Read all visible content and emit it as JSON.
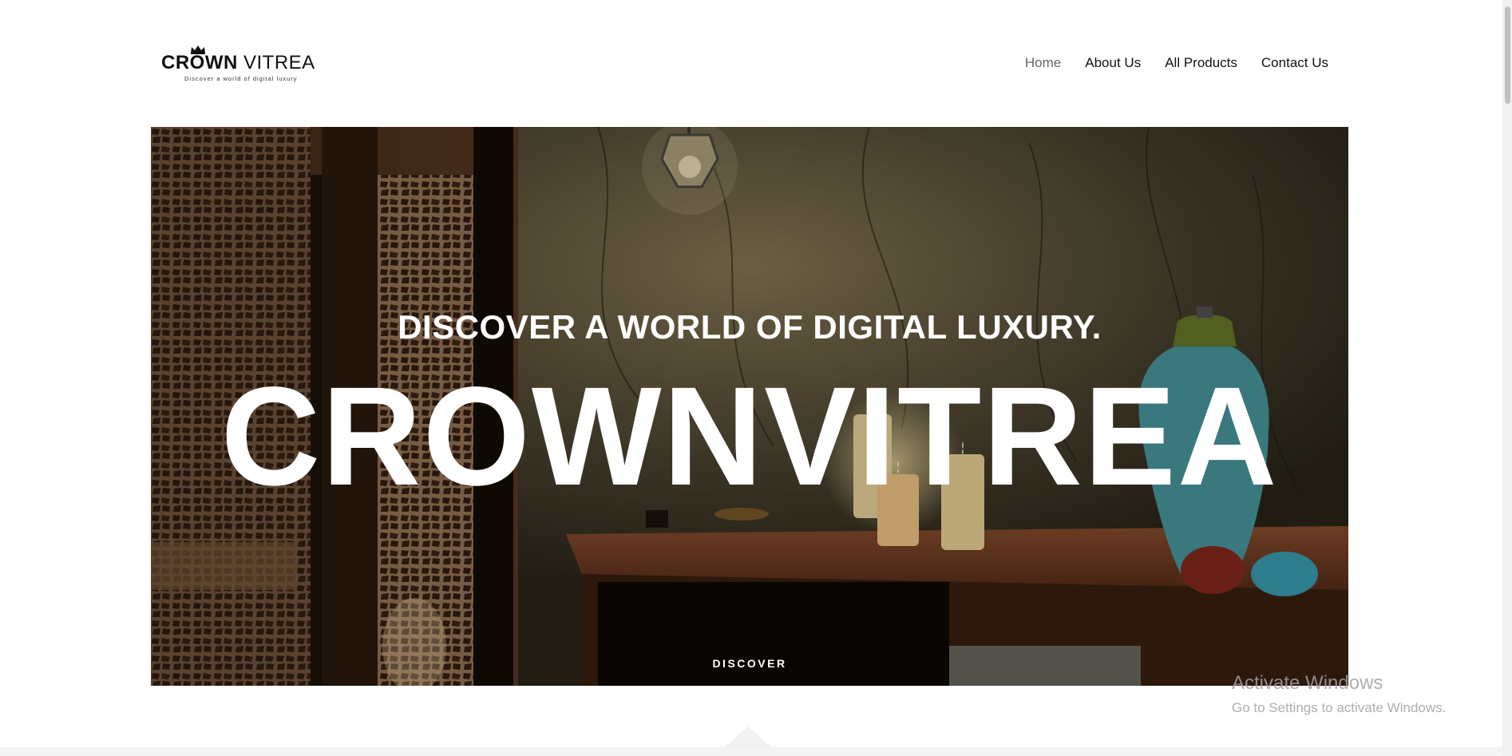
{
  "brand": {
    "name_bold": "CROWN",
    "name_light": "VITREA",
    "tagline": "Discover a world of digital luxury",
    "crown_icon": "crown-icon"
  },
  "nav": {
    "items": [
      {
        "label": "Home",
        "active": true
      },
      {
        "label": "About Us",
        "active": false
      },
      {
        "label": "All Products",
        "active": false
      },
      {
        "label": "Contact Us",
        "active": false
      }
    ]
  },
  "hero": {
    "subtitle": "DISCOVER A WORLD OF DIGITAL LUXURY.",
    "title": "CROWNVITREA",
    "cta_label": "DISCOVER",
    "background_image": "dark stone-tiled spa room with candles, vase and hanging lantern"
  },
  "watermark": {
    "title": "Activate Windows",
    "subtitle": "Go to Settings to activate Windows."
  },
  "colors": {
    "nav_text": "#111111",
    "nav_active": "#666666",
    "hero_text": "#ffffff",
    "page_bg": "#ffffff"
  }
}
